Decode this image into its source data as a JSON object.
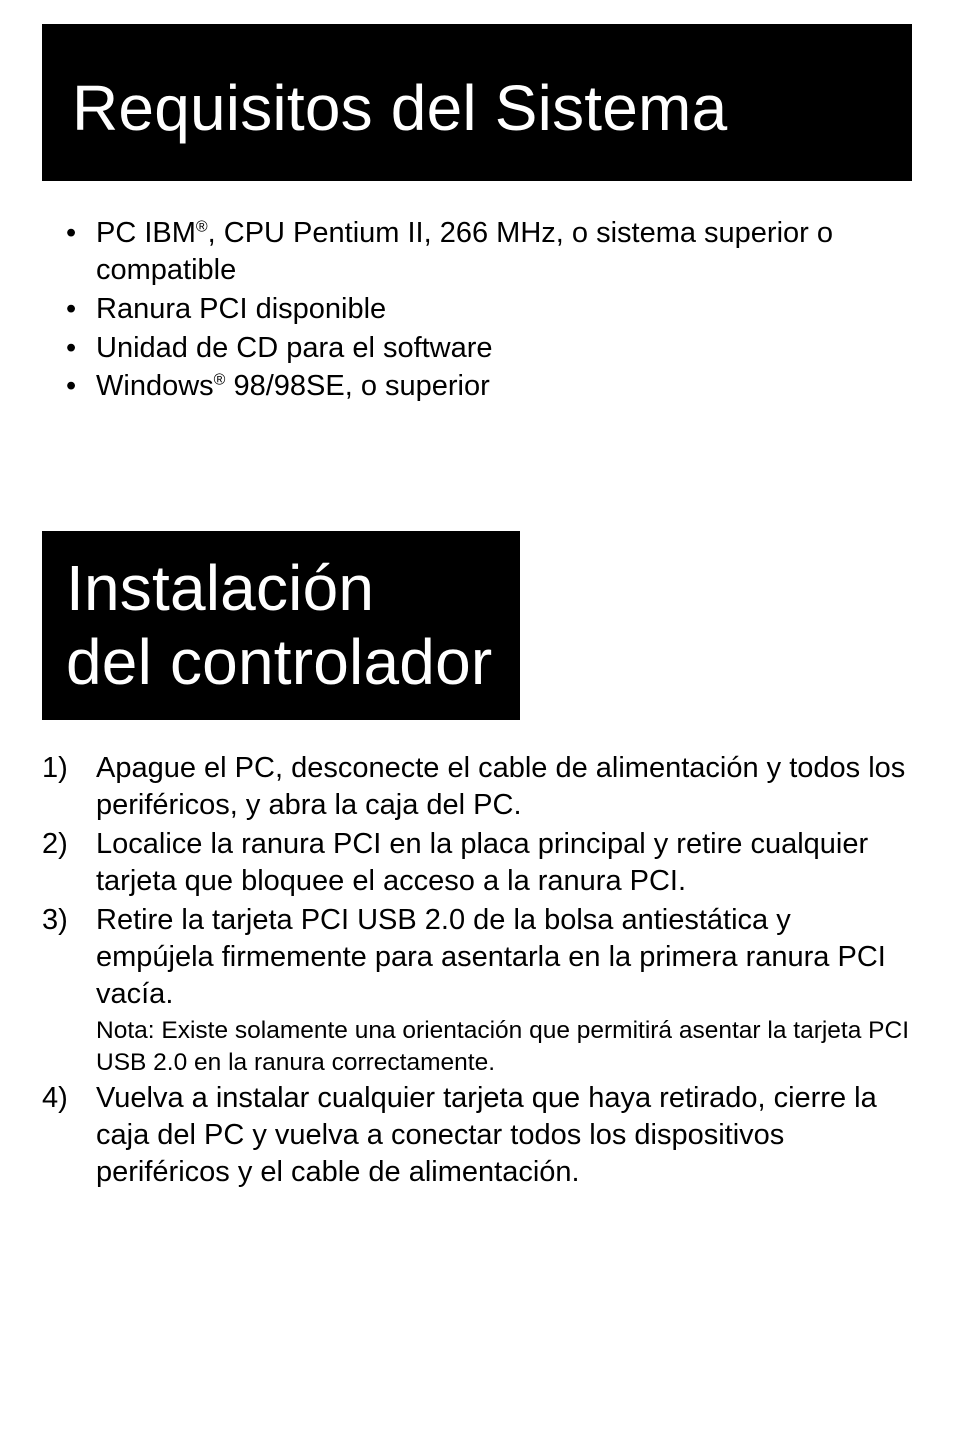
{
  "headings": {
    "section1": "Requisitos del Sistema",
    "section2_line1": "Instalación",
    "section2_line2": "del controlador"
  },
  "requirements": {
    "items": [
      {
        "pre": "PC IBM",
        "sup": "®",
        "post": ", CPU Pentium II, 266 MHz, o sistema superior o compatible"
      },
      {
        "pre": "Ranura PCI disponible",
        "sup": "",
        "post": ""
      },
      {
        "pre": "Unidad de CD para el software",
        "sup": "",
        "post": ""
      },
      {
        "pre": "Windows",
        "sup": "®",
        "post": " 98/98SE, o superior"
      }
    ]
  },
  "steps": [
    {
      "num": "1)",
      "text": "Apague el PC, desconecte el cable de alimentación y todos los periféricos, y abra la caja del PC.",
      "note": ""
    },
    {
      "num": "2)",
      "text": "Localice la ranura PCI en la placa principal y retire cualquier tarjeta que bloquee el acceso a la ranura PCI.",
      "note": ""
    },
    {
      "num": "3)",
      "text": "Retire la tarjeta PCI USB 2.0 de la bolsa antiestática y empújela firmemente para asentarla en la primera ranura PCI vacía.",
      "note": "Nota: Existe solamente una orientación que permitirá asentar la tarjeta PCI USB 2.0 en la ranura correctamente."
    },
    {
      "num": "4)",
      "text": "Vuelva a instalar cualquier tarjeta que haya retirado, cierre la caja del PC y vuelva a conectar todos los dispositivos periféricos y el cable de alimentación.",
      "note": ""
    }
  ]
}
